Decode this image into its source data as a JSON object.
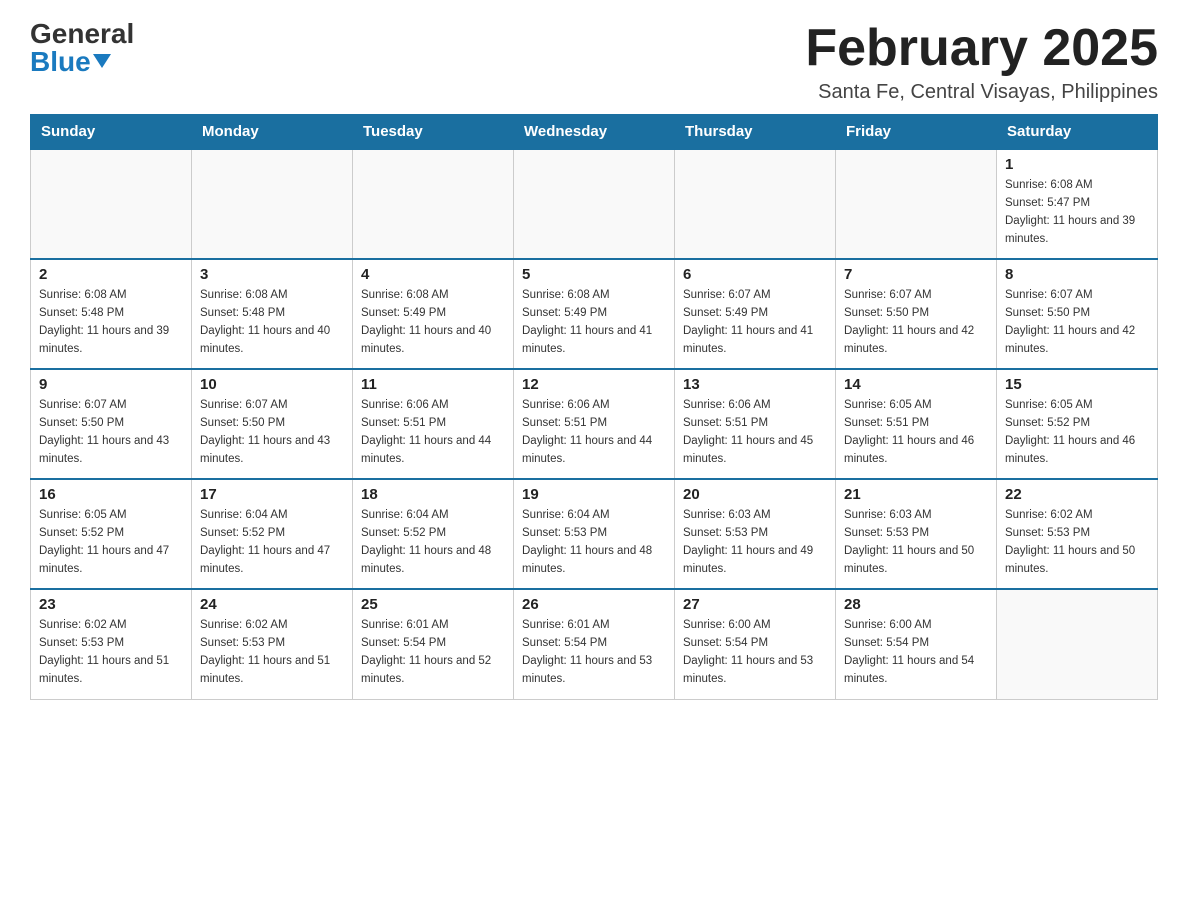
{
  "logo": {
    "general": "General",
    "blue": "Blue",
    "triangle": "▼"
  },
  "title": "February 2025",
  "subtitle": "Santa Fe, Central Visayas, Philippines",
  "days_of_week": [
    "Sunday",
    "Monday",
    "Tuesday",
    "Wednesday",
    "Thursday",
    "Friday",
    "Saturday"
  ],
  "weeks": [
    [
      {
        "day": "",
        "sunrise": "",
        "sunset": "",
        "daylight": ""
      },
      {
        "day": "",
        "sunrise": "",
        "sunset": "",
        "daylight": ""
      },
      {
        "day": "",
        "sunrise": "",
        "sunset": "",
        "daylight": ""
      },
      {
        "day": "",
        "sunrise": "",
        "sunset": "",
        "daylight": ""
      },
      {
        "day": "",
        "sunrise": "",
        "sunset": "",
        "daylight": ""
      },
      {
        "day": "",
        "sunrise": "",
        "sunset": "",
        "daylight": ""
      },
      {
        "day": "1",
        "sunrise": "Sunrise: 6:08 AM",
        "sunset": "Sunset: 5:47 PM",
        "daylight": "Daylight: 11 hours and 39 minutes."
      }
    ],
    [
      {
        "day": "2",
        "sunrise": "Sunrise: 6:08 AM",
        "sunset": "Sunset: 5:48 PM",
        "daylight": "Daylight: 11 hours and 39 minutes."
      },
      {
        "day": "3",
        "sunrise": "Sunrise: 6:08 AM",
        "sunset": "Sunset: 5:48 PM",
        "daylight": "Daylight: 11 hours and 40 minutes."
      },
      {
        "day": "4",
        "sunrise": "Sunrise: 6:08 AM",
        "sunset": "Sunset: 5:49 PM",
        "daylight": "Daylight: 11 hours and 40 minutes."
      },
      {
        "day": "5",
        "sunrise": "Sunrise: 6:08 AM",
        "sunset": "Sunset: 5:49 PM",
        "daylight": "Daylight: 11 hours and 41 minutes."
      },
      {
        "day": "6",
        "sunrise": "Sunrise: 6:07 AM",
        "sunset": "Sunset: 5:49 PM",
        "daylight": "Daylight: 11 hours and 41 minutes."
      },
      {
        "day": "7",
        "sunrise": "Sunrise: 6:07 AM",
        "sunset": "Sunset: 5:50 PM",
        "daylight": "Daylight: 11 hours and 42 minutes."
      },
      {
        "day": "8",
        "sunrise": "Sunrise: 6:07 AM",
        "sunset": "Sunset: 5:50 PM",
        "daylight": "Daylight: 11 hours and 42 minutes."
      }
    ],
    [
      {
        "day": "9",
        "sunrise": "Sunrise: 6:07 AM",
        "sunset": "Sunset: 5:50 PM",
        "daylight": "Daylight: 11 hours and 43 minutes."
      },
      {
        "day": "10",
        "sunrise": "Sunrise: 6:07 AM",
        "sunset": "Sunset: 5:50 PM",
        "daylight": "Daylight: 11 hours and 43 minutes."
      },
      {
        "day": "11",
        "sunrise": "Sunrise: 6:06 AM",
        "sunset": "Sunset: 5:51 PM",
        "daylight": "Daylight: 11 hours and 44 minutes."
      },
      {
        "day": "12",
        "sunrise": "Sunrise: 6:06 AM",
        "sunset": "Sunset: 5:51 PM",
        "daylight": "Daylight: 11 hours and 44 minutes."
      },
      {
        "day": "13",
        "sunrise": "Sunrise: 6:06 AM",
        "sunset": "Sunset: 5:51 PM",
        "daylight": "Daylight: 11 hours and 45 minutes."
      },
      {
        "day": "14",
        "sunrise": "Sunrise: 6:05 AM",
        "sunset": "Sunset: 5:51 PM",
        "daylight": "Daylight: 11 hours and 46 minutes."
      },
      {
        "day": "15",
        "sunrise": "Sunrise: 6:05 AM",
        "sunset": "Sunset: 5:52 PM",
        "daylight": "Daylight: 11 hours and 46 minutes."
      }
    ],
    [
      {
        "day": "16",
        "sunrise": "Sunrise: 6:05 AM",
        "sunset": "Sunset: 5:52 PM",
        "daylight": "Daylight: 11 hours and 47 minutes."
      },
      {
        "day": "17",
        "sunrise": "Sunrise: 6:04 AM",
        "sunset": "Sunset: 5:52 PM",
        "daylight": "Daylight: 11 hours and 47 minutes."
      },
      {
        "day": "18",
        "sunrise": "Sunrise: 6:04 AM",
        "sunset": "Sunset: 5:52 PM",
        "daylight": "Daylight: 11 hours and 48 minutes."
      },
      {
        "day": "19",
        "sunrise": "Sunrise: 6:04 AM",
        "sunset": "Sunset: 5:53 PM",
        "daylight": "Daylight: 11 hours and 48 minutes."
      },
      {
        "day": "20",
        "sunrise": "Sunrise: 6:03 AM",
        "sunset": "Sunset: 5:53 PM",
        "daylight": "Daylight: 11 hours and 49 minutes."
      },
      {
        "day": "21",
        "sunrise": "Sunrise: 6:03 AM",
        "sunset": "Sunset: 5:53 PM",
        "daylight": "Daylight: 11 hours and 50 minutes."
      },
      {
        "day": "22",
        "sunrise": "Sunrise: 6:02 AM",
        "sunset": "Sunset: 5:53 PM",
        "daylight": "Daylight: 11 hours and 50 minutes."
      }
    ],
    [
      {
        "day": "23",
        "sunrise": "Sunrise: 6:02 AM",
        "sunset": "Sunset: 5:53 PM",
        "daylight": "Daylight: 11 hours and 51 minutes."
      },
      {
        "day": "24",
        "sunrise": "Sunrise: 6:02 AM",
        "sunset": "Sunset: 5:53 PM",
        "daylight": "Daylight: 11 hours and 51 minutes."
      },
      {
        "day": "25",
        "sunrise": "Sunrise: 6:01 AM",
        "sunset": "Sunset: 5:54 PM",
        "daylight": "Daylight: 11 hours and 52 minutes."
      },
      {
        "day": "26",
        "sunrise": "Sunrise: 6:01 AM",
        "sunset": "Sunset: 5:54 PM",
        "daylight": "Daylight: 11 hours and 53 minutes."
      },
      {
        "day": "27",
        "sunrise": "Sunrise: 6:00 AM",
        "sunset": "Sunset: 5:54 PM",
        "daylight": "Daylight: 11 hours and 53 minutes."
      },
      {
        "day": "28",
        "sunrise": "Sunrise: 6:00 AM",
        "sunset": "Sunset: 5:54 PM",
        "daylight": "Daylight: 11 hours and 54 minutes."
      },
      {
        "day": "",
        "sunrise": "",
        "sunset": "",
        "daylight": ""
      }
    ]
  ]
}
